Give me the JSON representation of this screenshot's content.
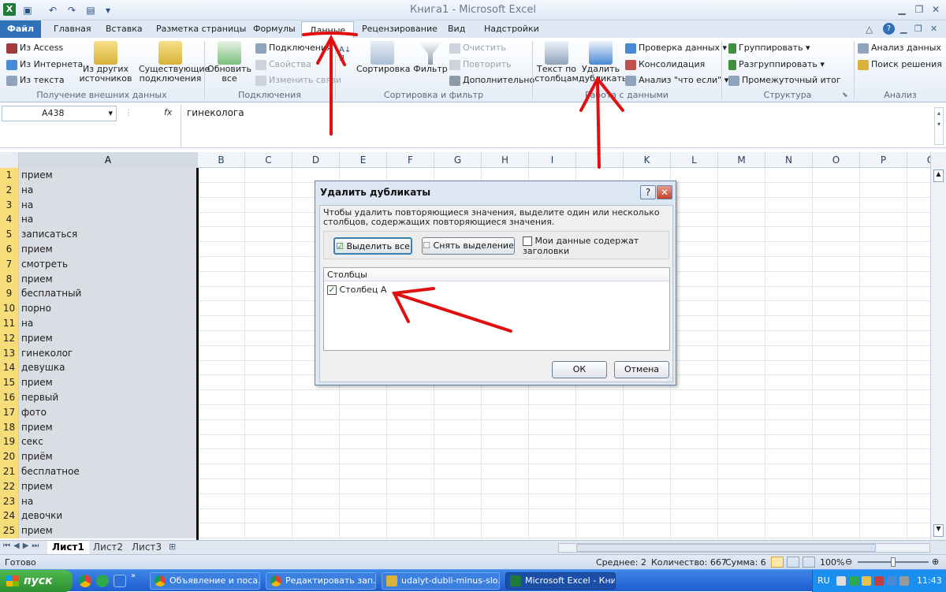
{
  "window": {
    "title": "Книга1  -  Microsoft Excel"
  },
  "tabs": [
    {
      "label": "Файл"
    },
    {
      "label": "Главная"
    },
    {
      "label": "Вставка"
    },
    {
      "label": "Разметка страницы"
    },
    {
      "label": "Формулы"
    },
    {
      "label": "Данные"
    },
    {
      "label": "Рецензирование"
    },
    {
      "label": "Вид"
    },
    {
      "label": "Надстройки"
    }
  ],
  "ribbon": {
    "external": {
      "access": "Из Access",
      "web": "Из Интернета",
      "text": "Из текста",
      "other1": "Из других",
      "other2": "источников",
      "existing1": "Существующие",
      "existing2": "подключения",
      "group": "Получение внешних данных"
    },
    "connections": {
      "refresh1": "Обновить",
      "refresh2": "все",
      "conn": "Подключения",
      "props": "Свойства",
      "edit_links": "Изменить связи",
      "group": "Подключения"
    },
    "sort": {
      "sort": "Сортировка",
      "filter": "Фильтр",
      "clear": "Очистить",
      "reapply": "Повторить",
      "advanced": "Дополнительно",
      "group": "Сортировка и фильтр"
    },
    "tools": {
      "text_cols1": "Текст по",
      "text_cols2": "столбцам",
      "remove_dup1": "Удалить",
      "remove_dup2": "дубликаты",
      "validation": "Проверка данных",
      "consolidate": "Консолидация",
      "whatif": "Анализ \"что если\"",
      "group": "Работа с данными"
    },
    "outline": {
      "group_btn": "Группировать",
      "ungroup": "Разгруппировать",
      "subtotal": "Промежуточный итог",
      "group": "Структура"
    },
    "analysis": {
      "data_analysis": "Анализ данных",
      "solver": "Поиск решения",
      "group": "Анализ"
    }
  },
  "formula_bar": {
    "name_box": "A438",
    "fx": "fx",
    "value": "гинеколога"
  },
  "columns": [
    "A",
    "B",
    "C",
    "D",
    "E",
    "F",
    "G",
    "H",
    "I",
    "J",
    "K",
    "L",
    "M",
    "N",
    "O",
    "P",
    "Q"
  ],
  "rows": [
    {
      "n": "1",
      "a": "прием"
    },
    {
      "n": "2",
      "a": "на"
    },
    {
      "n": "3",
      "a": "на"
    },
    {
      "n": "4",
      "a": "на"
    },
    {
      "n": "5",
      "a": "записаться"
    },
    {
      "n": "6",
      "a": "прием"
    },
    {
      "n": "7",
      "a": "смотреть"
    },
    {
      "n": "8",
      "a": "прием"
    },
    {
      "n": "9",
      "a": "бесплатный"
    },
    {
      "n": "10",
      "a": "порно"
    },
    {
      "n": "11",
      "a": "на"
    },
    {
      "n": "12",
      "a": "прием"
    },
    {
      "n": "13",
      "a": "гинеколог"
    },
    {
      "n": "14",
      "a": "девушка"
    },
    {
      "n": "15",
      "a": "прием"
    },
    {
      "n": "16",
      "a": "первый"
    },
    {
      "n": "17",
      "a": "фото"
    },
    {
      "n": "18",
      "a": "прием"
    },
    {
      "n": "19",
      "a": "секс"
    },
    {
      "n": "20",
      "a": "приём"
    },
    {
      "n": "21",
      "a": "бесплатное"
    },
    {
      "n": "22",
      "a": "прием"
    },
    {
      "n": "23",
      "a": "на"
    },
    {
      "n": "24",
      "a": "девочки"
    },
    {
      "n": "25",
      "a": "прием"
    }
  ],
  "sheet_tabs": [
    "Лист1",
    "Лист2",
    "Лист3"
  ],
  "status": {
    "ready": "Готово",
    "avg": "Среднее: 2",
    "count": "Количество: 667",
    "sum": "Сумма: 6",
    "zoom": "100%"
  },
  "dialog": {
    "title": "Удалить дубликаты",
    "help": "?",
    "close": "✕",
    "description": "Чтобы удалить повторяющиеся значения, выделите один или несколько столбцов, содержащих повторяющиеся значения.",
    "select_all": "Выделить все",
    "clear_selection": "Снять выделение",
    "has_headers": "Мои данные содержат заголовки",
    "columns_header": "Столбцы",
    "column_item": "Столбец A",
    "ok": "ОК",
    "cancel": "Отмена"
  },
  "taskbar": {
    "start": "пуск",
    "items": [
      "Объявление и поса...",
      "Редактировать зап...",
      "udalyt-dubli-minus-slo...",
      "Microsoft Excel - Кни..."
    ],
    "lang": "RU",
    "clock": "11:43"
  },
  "colors": {
    "file_tab": "#2f70b8",
    "annotation": "#e01010",
    "row_header_selected": "#f7dc7a",
    "taskbar": "#245edb",
    "start": "#3aa53a"
  }
}
